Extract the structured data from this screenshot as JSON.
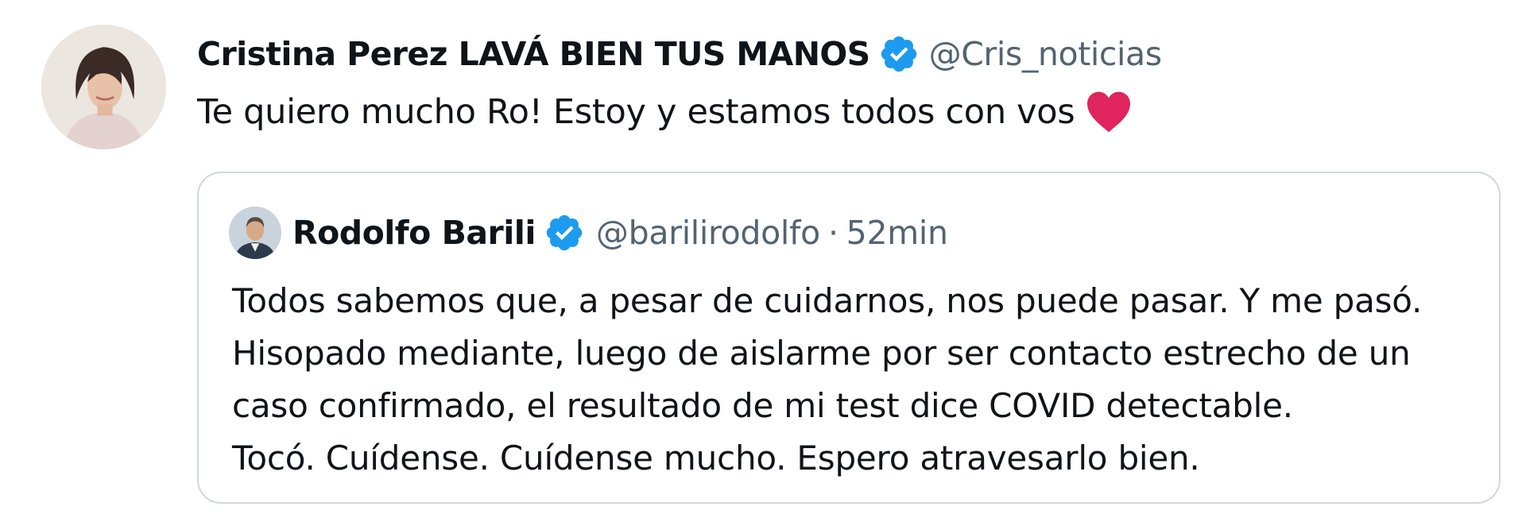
{
  "tweet": {
    "author": {
      "display_name": "Cristina Perez LAVÁ BIEN TUS MANOS",
      "handle": "@Cris_noticias",
      "verified": true
    },
    "text": "Te quiero mucho Ro! Estoy y estamos todos con vos",
    "emoji": "red-heart"
  },
  "quoted_tweet": {
    "author": {
      "display_name": "Rodolfo Barili",
      "handle": "@barilirodolfo",
      "verified": true
    },
    "separator": "·",
    "time": "52min",
    "lines": [
      "Todos sabemos que, a pesar de cuidarnos, nos puede pasar. Y me pasó.",
      "Hisopado mediante, luego de aislarme por ser contacto estrecho de un",
      "caso confirmado, el resultado de mi test dice COVID detectable.",
      "Tocó. Cuídense. Cuídense mucho. Espero atravesarlo bien."
    ]
  },
  "colors": {
    "verified_blue": "#1d9bf0",
    "heart_red": "#e0245e",
    "secondary_text": "#536471",
    "card_border": "#cfd9de"
  },
  "icons": {
    "verified": "verified-badge-icon",
    "heart": "heart-emoji-icon"
  }
}
